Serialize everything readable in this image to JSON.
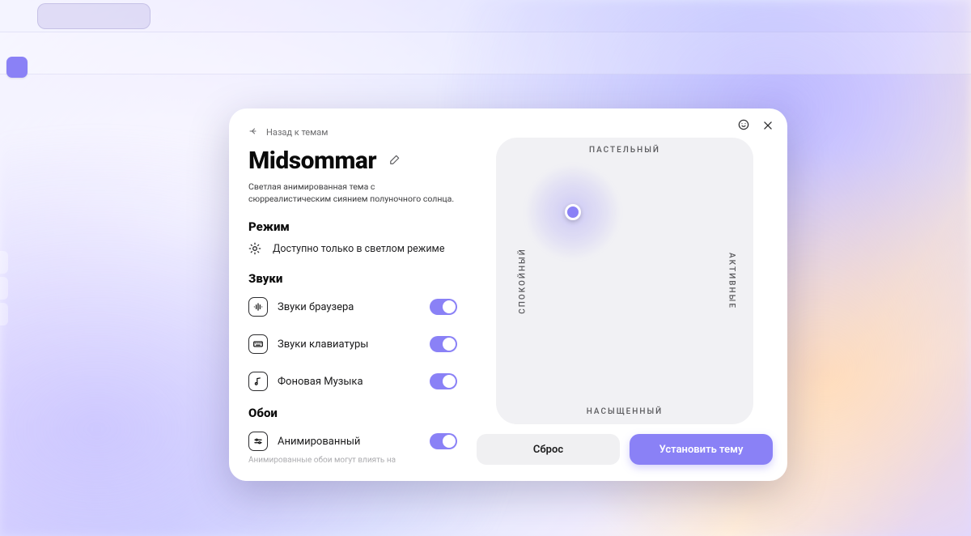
{
  "nav": {
    "back": "Назад к темам"
  },
  "title": "Midsommar",
  "description": "Светлая анимированная тема с сюрреалистическим сиянием полуночного солнца.",
  "sections": {
    "mode": {
      "heading": "Режим",
      "note": "Доступно только в светлом режиме"
    },
    "sounds": {
      "heading": "Звуки",
      "items": [
        {
          "label": "Звуки браузера",
          "icon": "audio-wave-icon",
          "on": true
        },
        {
          "label": "Звуки клавиатуры",
          "icon": "keyboard-icon",
          "on": true
        },
        {
          "label": "Фоновая Музыка",
          "icon": "music-note-icon",
          "on": true
        }
      ]
    },
    "wallpaper": {
      "heading": "Обои",
      "items": [
        {
          "label": "Анимированный",
          "icon": "sliders-icon",
          "on": true
        }
      ],
      "hint": "Анимированные обои могут влиять на"
    }
  },
  "picker": {
    "axes": {
      "top": "ПАСТЕЛЬНЫЙ",
      "bottom": "НАСЫЩЕННЫЙ",
      "left": "СПОКОЙНЫЙ",
      "right": "АКТИВНЫЕ"
    },
    "pos": {
      "x_pct": 30,
      "y_pct": 26
    }
  },
  "footer": {
    "reset": "Сброс",
    "apply": "Установить тему"
  },
  "colors": {
    "accent": "#8a81f6"
  }
}
